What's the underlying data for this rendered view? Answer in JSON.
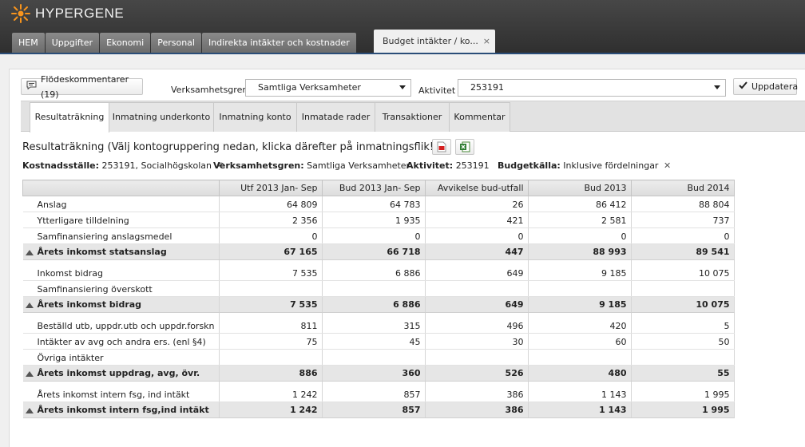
{
  "app": {
    "brand": "HYPERGENE",
    "brand_color": "#f7941d"
  },
  "main_tabs": [
    "HEM",
    "Uppgifter",
    "Ekonomi",
    "Personal",
    "Indirekta intäkter och kostnader"
  ],
  "active_main_tab": {
    "label": "Budget intäkter / ko...",
    "close": "×"
  },
  "toolbar": {
    "comments_button": "Flödeskommentarer (19)",
    "verksamhetsgren_label": "Verksamhetsgren",
    "verksamhetsgren_value": "Samtliga Verksamheter",
    "aktivitet_label": "Aktivitet",
    "aktivitet_value": "253191",
    "update_button": "Uppdatera"
  },
  "sub_tabs": [
    "Resultaträkning",
    "Inmatning underkonto",
    "Inmatning konto",
    "Inmatade rader",
    "Transaktioner",
    "Kommentar"
  ],
  "page_title": "Resultaträkning (Välj kontogruppering nedan, klicka därefter på inmatningsflik!)",
  "info": {
    "kostnadsstalle_label": "Kostnadsställe:",
    "kostnadsstalle_value": "253191, Socialhögskolan",
    "verksamhetsgren_label": "Verksamhetsgren:",
    "verksamhetsgren_value": "Samtliga Verksamheter",
    "aktivitet_label": "Aktivitet:",
    "aktivitet_value": "253191",
    "budgetkalla_label": "Budgetkälla:",
    "budgetkalla_value": "Inklusive fördelningar"
  },
  "table": {
    "columns": [
      "",
      "Utf 2013 Jan- Sep",
      "Bud 2013 Jan- Sep",
      "Avvikelse bud-utfall",
      "Bud 2013",
      "Bud 2014"
    ],
    "rows": [
      {
        "type": "norm",
        "cells": [
          "Anslag",
          "64 809",
          "64 783",
          "26",
          "86 412",
          "88 804"
        ]
      },
      {
        "type": "norm",
        "cells": [
          "Ytterligare tilldelning",
          "2 356",
          "1 935",
          "421",
          "2 581",
          "737"
        ]
      },
      {
        "type": "norm",
        "cells": [
          "Samfinansiering anslagsmedel",
          "0",
          "0",
          "0",
          "0",
          "0"
        ]
      },
      {
        "type": "sum",
        "cells": [
          "Årets inkomst statsanslag",
          "67 165",
          "66 718",
          "447",
          "88 993",
          "89 541"
        ]
      },
      {
        "type": "tall",
        "cells": [
          "Inkomst bidrag",
          "7 535",
          "6 886",
          "649",
          "9 185",
          "10 075"
        ]
      },
      {
        "type": "norm",
        "cells": [
          "Samfinansiering överskott",
          "",
          "",
          "",
          "",
          ""
        ]
      },
      {
        "type": "sum",
        "cells": [
          "Årets inkomst bidrag",
          "7 535",
          "6 886",
          "649",
          "9 185",
          "10 075"
        ]
      },
      {
        "type": "tall",
        "cells": [
          "Beställd utb, uppdr.utb och uppdr.forskn",
          "811",
          "315",
          "496",
          "420",
          "5"
        ]
      },
      {
        "type": "norm",
        "cells": [
          "Intäkter av avg och andra ers. (enl §4)",
          "75",
          "45",
          "30",
          "60",
          "50"
        ]
      },
      {
        "type": "norm",
        "cells": [
          "Övriga intäkter",
          "",
          "",
          "",
          "",
          ""
        ]
      },
      {
        "type": "sum",
        "cells": [
          "Årets inkomst uppdrag, avg, övr.",
          "886",
          "360",
          "526",
          "480",
          "55"
        ]
      },
      {
        "type": "tall",
        "cells": [
          "Årets inkomst intern fsg, ind intäkt",
          "1 242",
          "857",
          "386",
          "1 143",
          "1 995"
        ]
      },
      {
        "type": "sum",
        "cells": [
          "Årets inkomst intern fsg,ind intäkt",
          "1 242",
          "857",
          "386",
          "1 143",
          "1 995"
        ]
      }
    ]
  }
}
